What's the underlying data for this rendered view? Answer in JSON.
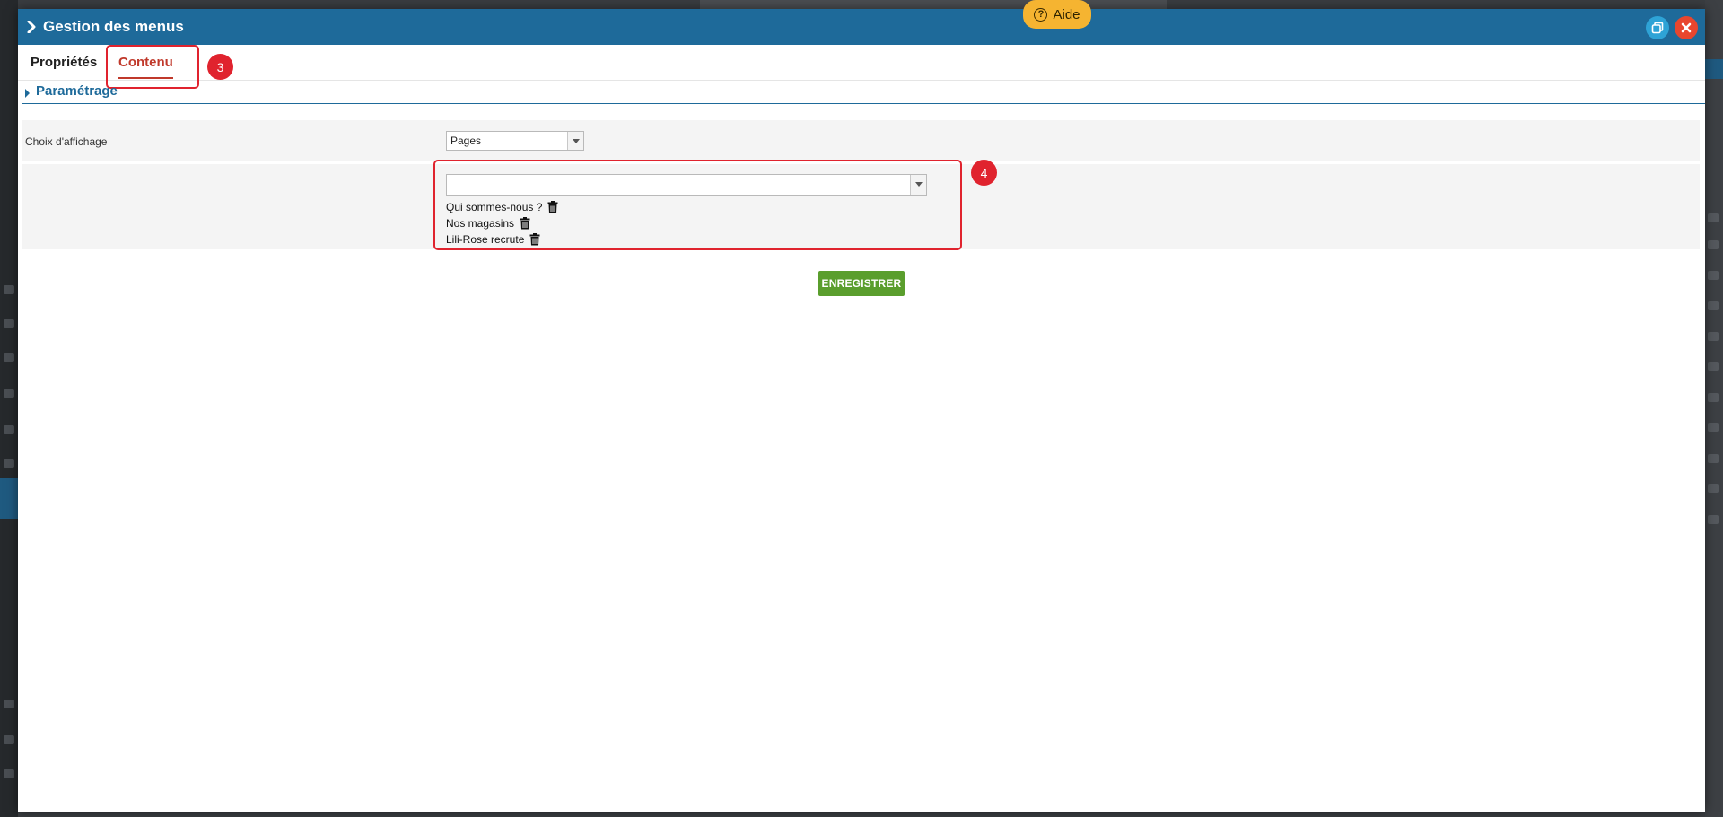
{
  "modal": {
    "title": "Gestion des menus"
  },
  "help": {
    "label": "Aide",
    "icon": "question-circle-icon"
  },
  "tabs": [
    {
      "label": "Propriétés",
      "active": false
    },
    {
      "label": "Contenu",
      "active": true
    }
  ],
  "annotations": {
    "step3": "3",
    "step4": "4"
  },
  "section": {
    "title": "Paramétrage"
  },
  "form": {
    "display_choice_label": "Choix d'affichage",
    "display_choice_value": "Pages",
    "page_select_value": "",
    "pages": [
      {
        "label": "Qui sommes-nous ?",
        "icon": "trash-icon"
      },
      {
        "label": "Nos magasins",
        "icon": "trash-icon"
      },
      {
        "label": "Lili-Rose recrute",
        "icon": "trash-icon"
      }
    ]
  },
  "actions": {
    "save_label": "ENREGISTRER"
  },
  "colors": {
    "header": "#1e6a9a",
    "active_tab": "#c0392b",
    "save": "#5a9e2d",
    "help": "#f5b431",
    "close": "#e8462e",
    "restore": "#2ea3d6",
    "callout": "#e0232e"
  }
}
